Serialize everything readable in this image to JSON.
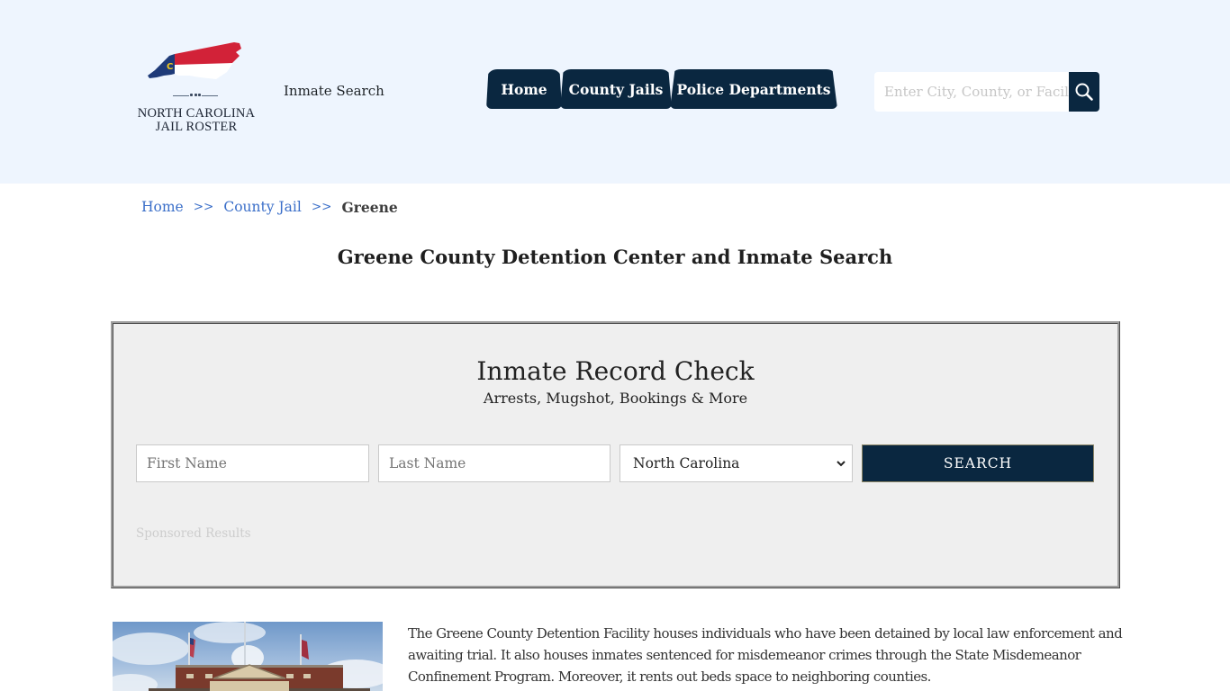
{
  "header": {
    "logo": {
      "line1": "NORTH CAROLINA",
      "line2": "JAIL ROSTER",
      "flag_colors": {
        "blue": "#1e3a78",
        "red": "#d22238",
        "white": "#ffffff",
        "gold": "#f2c81d"
      }
    },
    "inmate_search_link": "Inmate Search",
    "nav": [
      {
        "label": "Home"
      },
      {
        "label": "County Jails"
      },
      {
        "label": "Police Departments"
      }
    ],
    "search": {
      "placeholder": "Enter City, County, or Facility",
      "value": "",
      "icon": "search-icon"
    }
  },
  "breadcrumb": {
    "items": [
      {
        "label": "Home"
      },
      {
        "label": "County Jail"
      }
    ],
    "separator": ">>",
    "current": "Greene"
  },
  "page_title": "Greene County Detention Center and Inmate Search",
  "record_check": {
    "title": "Inmate Record Check",
    "subtitle": "Arrests, Mugshot, Bookings & More",
    "first_name_placeholder": "First Name",
    "last_name_placeholder": "Last Name",
    "state_selected": "North Carolina",
    "search_label": "SEARCH",
    "sponsored_label": "Sponsored Results"
  },
  "content": {
    "image_alt": "Greene County Detention Center building",
    "description": "The Greene County Detention Facility houses individuals who have been detained by local law enforcement and awaiting trial. It also houses inmates sentenced for misdemeanor crimes through the State Misdemeanor Confinement Program. Moreover, it rents out beds space to neighboring counties."
  },
  "colors": {
    "header_bg": "#eef5fe",
    "navy": "#0a2740",
    "link_blue": "#3b6fc9",
    "panel_bg": "#efefef"
  }
}
